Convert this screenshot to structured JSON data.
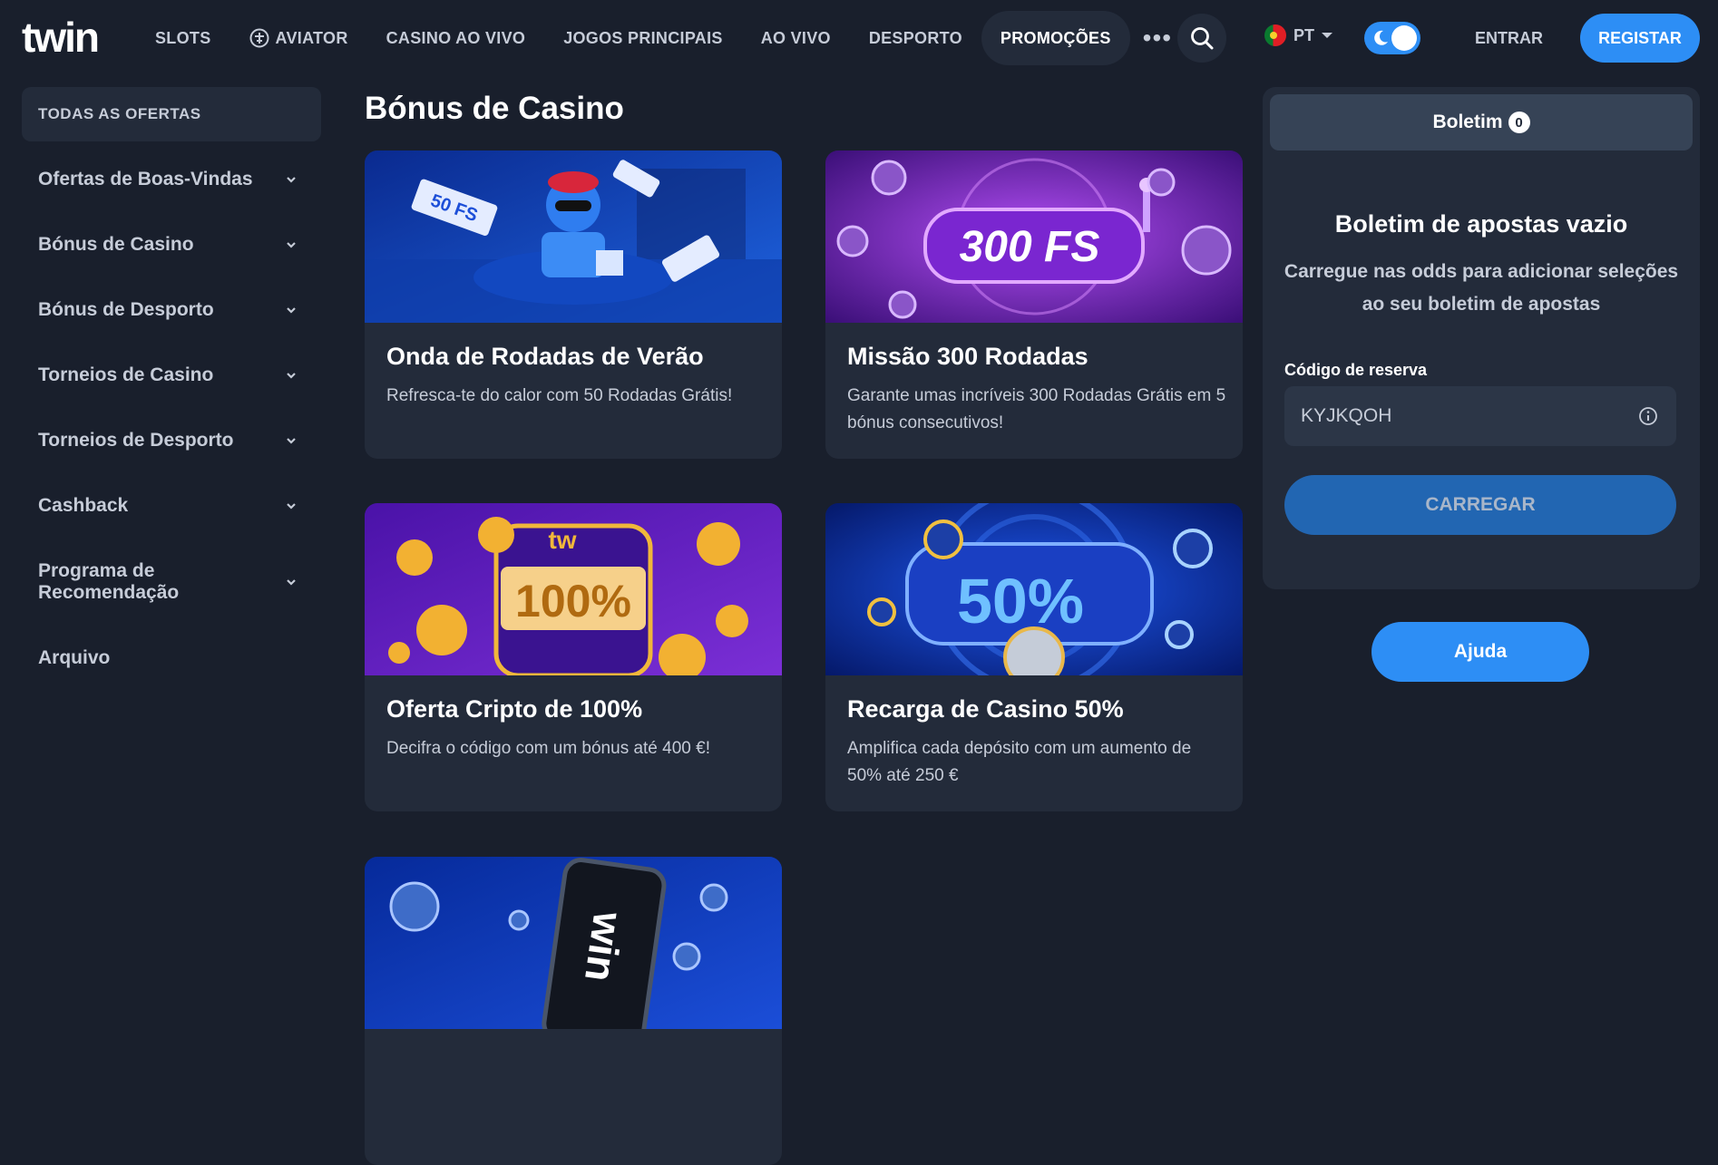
{
  "header": {
    "logo": "twin",
    "nav": [
      {
        "label": "SLOTS"
      },
      {
        "label": "AVIATOR"
      },
      {
        "label": "CASINO AO VIVO"
      },
      {
        "label": "JOGOS PRINCIPAIS"
      },
      {
        "label": "AO VIVO"
      },
      {
        "label": "DESPORTO"
      },
      {
        "label": "PROMOÇÕES",
        "active": true
      }
    ],
    "more": "•••",
    "language": "PT",
    "login": "ENTRAR",
    "register": "REGISTAR"
  },
  "sidebar": {
    "all_offers": "TODAS AS OFERTAS",
    "items": [
      {
        "label": "Ofertas de Boas-Vindas"
      },
      {
        "label": "Bónus de Casino"
      },
      {
        "label": "Bónus de Desporto"
      },
      {
        "label": "Torneios de Casino"
      },
      {
        "label": "Torneios de Desporto"
      },
      {
        "label": "Cashback"
      },
      {
        "label": "Programa de Recomendação"
      },
      {
        "label": "Arquivo"
      }
    ]
  },
  "main": {
    "title": "Bónus de Casino",
    "cards": [
      {
        "title": "Onda de Rodadas de Verão",
        "description": "Refresca-te do calor com 50 Rodadas Grátis!",
        "banner_text": "50 FS"
      },
      {
        "title": "Missão 300 Rodadas",
        "description": "Garante umas incríveis 300 Rodadas Grátis em 5 bónus consecutivos!",
        "banner_text": "300 FS"
      },
      {
        "title": "Oferta Cripto de 100%",
        "description": "Decifra o código com um bónus até 400 €!",
        "banner_text": "100%"
      },
      {
        "title": "Recarga de Casino 50%",
        "description": "Amplifica cada depósito com um aumento de 50% até 250 €",
        "banner_text": "50%"
      },
      {
        "title": "",
        "description": "",
        "banner_text": "win"
      }
    ]
  },
  "betslip": {
    "tab_label": "Boletim",
    "count": "0",
    "empty_title": "Boletim de apostas vazio",
    "empty_desc": "Carregue nas odds para adicionar seleções ao seu boletim de apostas",
    "code_label": "Código de reserva",
    "code_value": "KYJKQOH",
    "load_button": "CARREGAR"
  },
  "help_button": "Ajuda",
  "colors": {
    "background": "#191f2c",
    "panel": "#232b3a",
    "accent": "#2d8ef5",
    "text_muted": "#c6ccd8"
  }
}
